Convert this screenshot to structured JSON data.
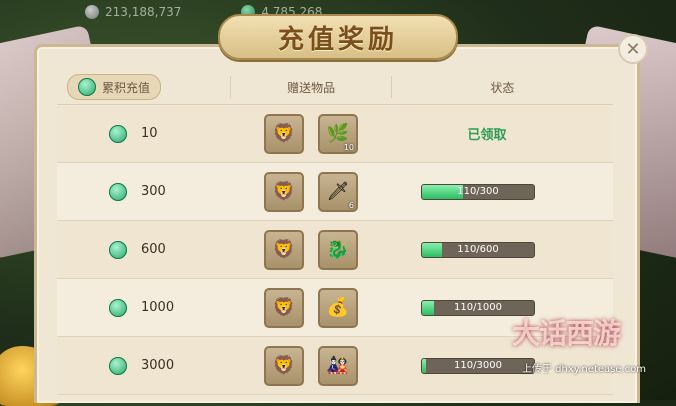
{
  "hud": {
    "silver_value": "213,188,737",
    "jade_value": "4,785,268"
  },
  "dialog": {
    "title": "充值奖励",
    "close_glyph": "✕",
    "headers": {
      "cumulative": "累积充值",
      "gift": "赠送物品",
      "status": "状态"
    },
    "rows": [
      {
        "amount": "10",
        "items": [
          {
            "icon": "🦁",
            "qty": ""
          },
          {
            "icon": "🌿",
            "qty": "10"
          }
        ],
        "status_type": "claimed",
        "status_text": "已领取",
        "progress": null
      },
      {
        "amount": "300",
        "items": [
          {
            "icon": "🦁",
            "qty": ""
          },
          {
            "icon": "🗡",
            "qty": "6"
          }
        ],
        "status_type": "progress",
        "progress": 0.367,
        "progress_text": "110/300"
      },
      {
        "amount": "600",
        "items": [
          {
            "icon": "🦁",
            "qty": ""
          },
          {
            "icon": "🐉",
            "qty": ""
          }
        ],
        "status_type": "progress",
        "progress": 0.183,
        "progress_text": "110/600"
      },
      {
        "amount": "1000",
        "items": [
          {
            "icon": "🦁",
            "qty": ""
          },
          {
            "icon": "💰",
            "qty": ""
          }
        ],
        "status_type": "progress",
        "progress": 0.11,
        "progress_text": "110/1000"
      },
      {
        "amount": "3000",
        "items": [
          {
            "icon": "🦁",
            "qty": ""
          },
          {
            "icon": "🎎",
            "qty": ""
          }
        ],
        "status_type": "progress",
        "progress": 0.037,
        "progress_text": "110/3000"
      }
    ]
  },
  "watermark": {
    "logo_text": "大话西游",
    "url": "上传于 dhxy.netease.com"
  },
  "colors": {
    "claimed_green": "#2f9c55",
    "progress_fill": "#2bbd63",
    "panel_bg": "#efe6d3"
  }
}
